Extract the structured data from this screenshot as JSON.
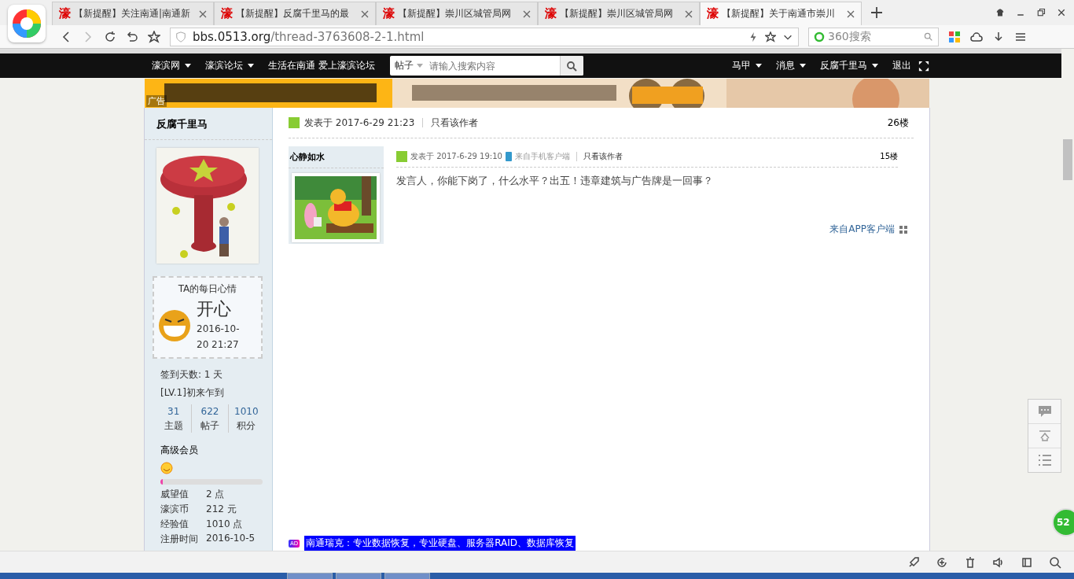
{
  "browser": {
    "tabs": [
      {
        "icon": "濠",
        "title": "【新提醒】关注南通|南通新",
        "selected": false
      },
      {
        "icon": "濠",
        "title": "【新提醒】反腐千里马的最",
        "selected": false
      },
      {
        "icon": "濠",
        "title": "【新提醒】崇川区城管局网",
        "selected": false
      },
      {
        "icon": "濠",
        "title": "【新提醒】崇川区城管局网",
        "selected": false
      },
      {
        "icon": "濠",
        "title": "【新提醒】关于南通市崇川",
        "selected": true
      }
    ],
    "address_host": "bbs.0513.org",
    "address_path": "/thread-3763608-2-1.html",
    "search_placeholder": "360搜索"
  },
  "nav": {
    "left": [
      {
        "label": "濠滨网",
        "dropdown": true
      },
      {
        "label": "濠滨论坛",
        "dropdown": true
      },
      {
        "label": "生活在南通 爱上濠滨论坛",
        "dropdown": false
      }
    ],
    "search_scope": "帖子",
    "search_placeholder": "请输入搜索内容",
    "right": [
      {
        "label": "马甲",
        "dropdown": true
      },
      {
        "label": "消息",
        "dropdown": true
      },
      {
        "label": "反腐千里马",
        "dropdown": true
      },
      {
        "label": "退出",
        "dropdown": false
      }
    ]
  },
  "banner": {
    "ad_label": "广告"
  },
  "author": {
    "name": "反腐千里马",
    "mood_title": "TA的每日心情",
    "mood": "开心",
    "mood_time": "2016-10-20 21:27",
    "checkin": "签到天数: 1 天",
    "rank": "[LV.1]初来乍到",
    "stats": [
      {
        "value": "31",
        "label": "主题"
      },
      {
        "value": "622",
        "label": "帖子"
      },
      {
        "value": "1010",
        "label": "积分"
      }
    ],
    "group": "高级会员",
    "progress": {
      "level": 0.02
    },
    "info": [
      {
        "label": "威望值",
        "value": "2 点"
      },
      {
        "label": "濠滨币",
        "value": "212 元"
      },
      {
        "label": "经验值",
        "value": "1010 点"
      },
      {
        "label": "注册时间",
        "value": "2016-10-5"
      }
    ]
  },
  "post": {
    "posted": "发表于 2017-6-29 21:23",
    "only_author": "只看该作者",
    "floor": "26楼",
    "quote": {
      "author": "心静如水",
      "posted": "发表于 2017-6-29 19:10",
      "source": "来自手机客户端",
      "only_author": "只看该作者",
      "floor": "15楼",
      "content": "发言人，你能下岗了，什么水平？出五！违章建筑与广告牌是一回事？"
    },
    "app_source": "来自APP客户端",
    "ad": {
      "badge": "AD",
      "text": "南通瑞克：专业数据恢复，专业硬盘、服务器RAID、数据库恢复"
    }
  },
  "floating_badge": "52"
}
